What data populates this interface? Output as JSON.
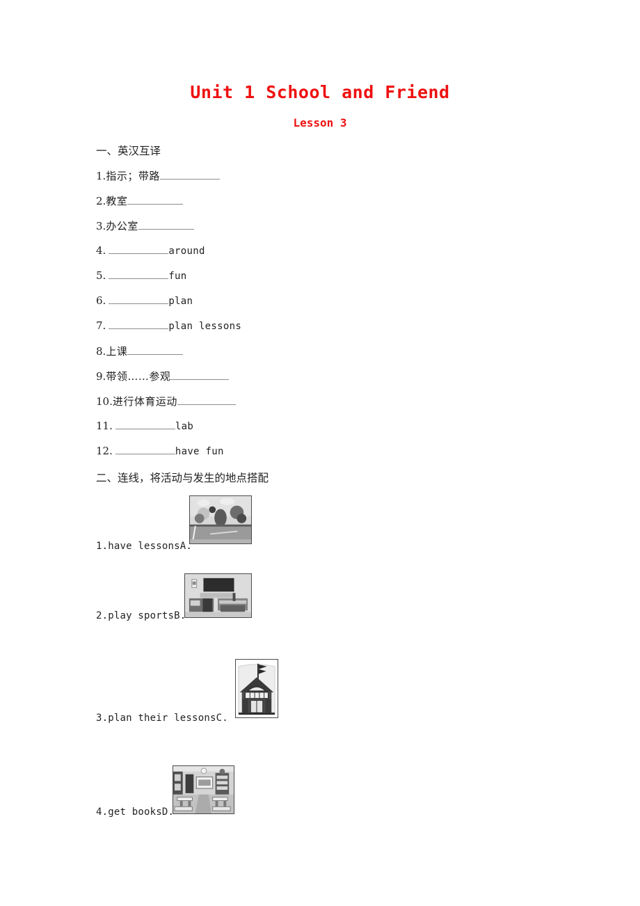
{
  "document": {
    "title": "Unit 1 School and Friend",
    "subtitle": "Lesson 3",
    "title_color": "#ee1111"
  },
  "section_one": {
    "heading": "一、英汉互译",
    "items": [
      {
        "num": "1.",
        "cn": "指示；带路",
        "en": "",
        "blank": "after"
      },
      {
        "num": "2.",
        "cn": "教室",
        "en": "",
        "blank": "after"
      },
      {
        "num": "3.",
        "cn": "办公室",
        "en": "",
        "blank": "after"
      },
      {
        "num": "4.",
        "cn": "",
        "en": "around",
        "blank": "before"
      },
      {
        "num": "5.",
        "cn": "",
        "en": "fun",
        "blank": "before"
      },
      {
        "num": "6.",
        "cn": "",
        "en": "plan",
        "blank": "before"
      },
      {
        "num": "7.",
        "cn": "",
        "en": "plan lessons",
        "blank": "before"
      },
      {
        "num": "8.",
        "cn": "上课",
        "en": "",
        "blank": "after"
      },
      {
        "num": "9.",
        "cn": "带领……参观",
        "en": "",
        "blank": "after"
      },
      {
        "num": "10.",
        "cn": "进行体育运动",
        "en": "",
        "blank": "after"
      },
      {
        "num": "11.",
        "cn": "",
        "en": "lab",
        "blank": "before"
      },
      {
        "num": "12.",
        "cn": "",
        "en": "have fun",
        "blank": "before"
      }
    ]
  },
  "section_two": {
    "heading": "二、连线，将活动与发生的地点搭配",
    "items": [
      {
        "label": "1.have lessonsA.",
        "picture": "sports-field-photo"
      },
      {
        "label": "2.play sportsB.",
        "picture": "classroom-front-photo"
      },
      {
        "label": "3.plan their lessonsC.",
        "picture": "school-building-drawing"
      },
      {
        "label": "4.get booksD.",
        "picture": "classroom-interior-photo"
      }
    ]
  }
}
